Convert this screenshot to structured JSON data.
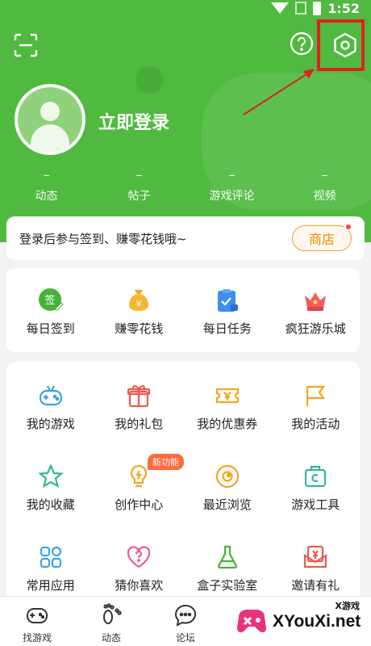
{
  "status_bar": {
    "time": "1:52"
  },
  "profile": {
    "login_text": "立即登录",
    "stats": [
      {
        "value": "–",
        "label": "动态"
      },
      {
        "value": "–",
        "label": "帖子"
      },
      {
        "value": "–",
        "label": "游戏评论"
      },
      {
        "value": "–",
        "label": "视频"
      }
    ]
  },
  "signin_banner": {
    "message": "登录后参与签到、赚零花钱哦~",
    "shop_label": "商店"
  },
  "quick_actions": [
    {
      "label": "每日签到",
      "icon": "checkin-icon"
    },
    {
      "label": "赚零花钱",
      "icon": "money-bag-icon"
    },
    {
      "label": "每日任务",
      "icon": "clipboard-icon"
    },
    {
      "label": "疯狂游乐城",
      "icon": "crown-icon"
    }
  ],
  "features": {
    "new_badge": "新功能",
    "items": [
      {
        "label": "我的游戏",
        "icon": "gamepad-icon"
      },
      {
        "label": "我的礼包",
        "icon": "gift-icon"
      },
      {
        "label": "我的优惠券",
        "icon": "coupon-icon"
      },
      {
        "label": "我的活动",
        "icon": "flag-icon"
      },
      {
        "label": "我的收藏",
        "icon": "star-icon"
      },
      {
        "label": "创作中心",
        "icon": "bulb-icon"
      },
      {
        "label": "最近浏览",
        "icon": "eye-icon"
      },
      {
        "label": "游戏工具",
        "icon": "toolbox-icon"
      },
      {
        "label": "常用应用",
        "icon": "apps-icon"
      },
      {
        "label": "猜你喜欢",
        "icon": "heart-question-icon"
      },
      {
        "label": "盒子实验室",
        "icon": "flask-icon"
      },
      {
        "label": "邀请有礼",
        "icon": "invite-icon"
      }
    ]
  },
  "bottom_nav": [
    {
      "label": "找游戏",
      "icon": "gamepad-nav-icon"
    },
    {
      "label": "动态",
      "icon": "footprints-icon"
    },
    {
      "label": "论坛",
      "icon": "chat-icon"
    }
  ],
  "watermark": {
    "text": "XYouXi.net",
    "small": "X游戏"
  },
  "colors": {
    "brand_green": "#4fba3f",
    "highlight_red": "#e02020",
    "accent_orange": "#f08a00"
  }
}
